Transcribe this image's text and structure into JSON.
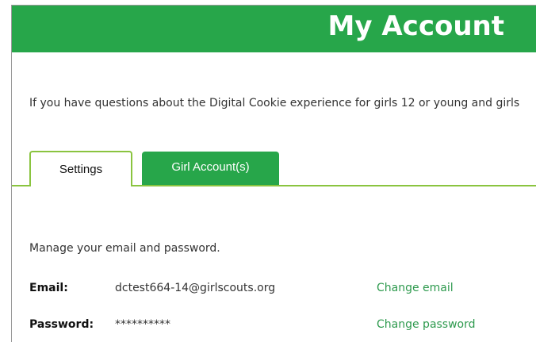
{
  "header": {
    "title": "My Account"
  },
  "intro": {
    "text": "If you have questions about the Digital Cookie experience for girls 12 or young and girls"
  },
  "tabs": [
    {
      "label": "Settings",
      "active": true
    },
    {
      "label": "Girl Account(s)",
      "active": false
    }
  ],
  "settings": {
    "manage_text": "Manage your email and password.",
    "email": {
      "label": "Email:",
      "value": "dctest664-14@girlscouts.org",
      "action": "Change email"
    },
    "password": {
      "label": "Password:",
      "value": "**********",
      "action": "Change password"
    }
  },
  "colors": {
    "brand_green": "#27a64a",
    "tab_border": "#8ac43f",
    "link_green": "#2e9a4e"
  }
}
